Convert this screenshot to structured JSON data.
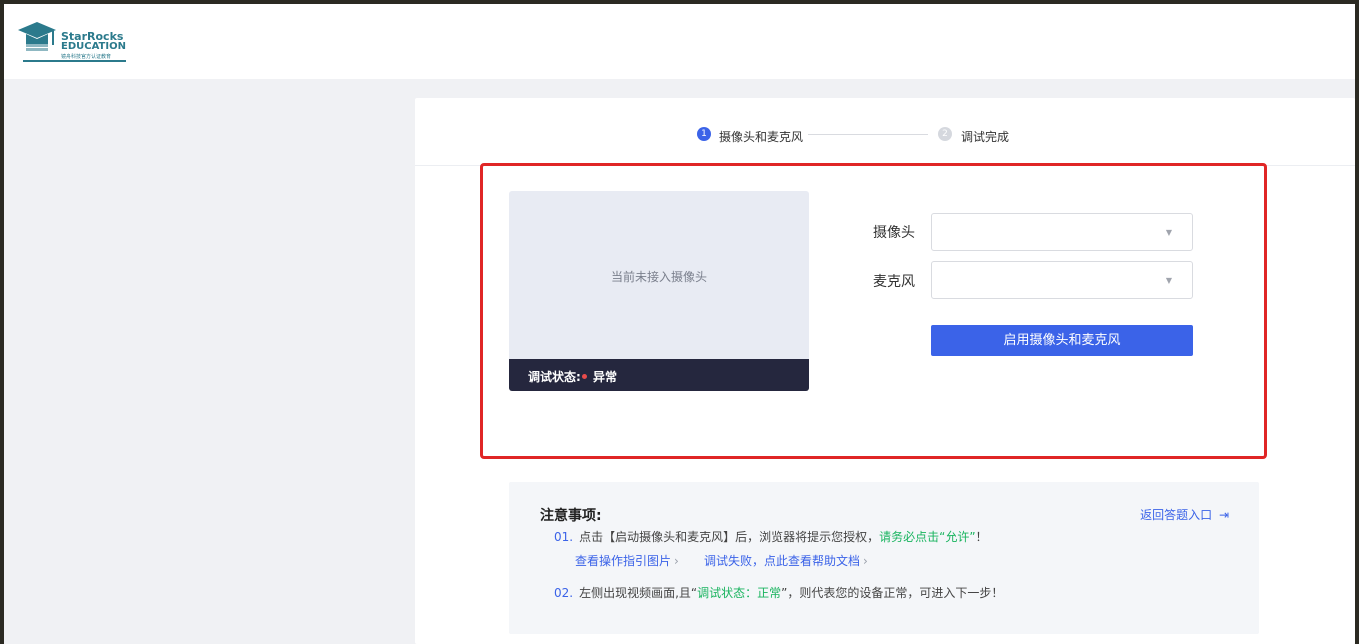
{
  "brand": {
    "name_line1": "StarRocks",
    "name_line2": "EDUCATION",
    "tagline": "镜舟科技官方认证教育",
    "color": "#2b7a8c"
  },
  "steps": [
    {
      "number": "1",
      "label": "摄像头和麦克风",
      "active": true
    },
    {
      "number": "2",
      "label": "调试完成",
      "active": false
    }
  ],
  "video": {
    "placeholder": "当前未接入摄像头",
    "status_label": "调试状态:",
    "status_value": "异常",
    "status_color": "#e84b4b"
  },
  "form": {
    "camera_label": "摄像头",
    "camera_value": "",
    "mic_label": "麦克风",
    "mic_value": "",
    "enable_button": "启用摄像头和麦克风"
  },
  "notes": {
    "title": "注意事项:",
    "back_link": "返回答题入口",
    "item1": {
      "number": "01.",
      "text_before": "点击【启动摄像头和麦克风】后，浏览器将提示您授权，",
      "highlight": "请务必点击“允许”",
      "text_after": "！",
      "link1": "查看操作指引图片",
      "link2": "调试失败，点此查看帮助文档"
    },
    "item2": {
      "number": "02.",
      "text_before": "左侧出现视频画面,且“",
      "highlight": "调试状态：正常",
      "text_after": "”，则代表您的设备正常，可进入下一步！"
    }
  },
  "colors": {
    "accent": "#3b63e8",
    "highlight": "#19b45f",
    "alert_border": "#e02626"
  }
}
